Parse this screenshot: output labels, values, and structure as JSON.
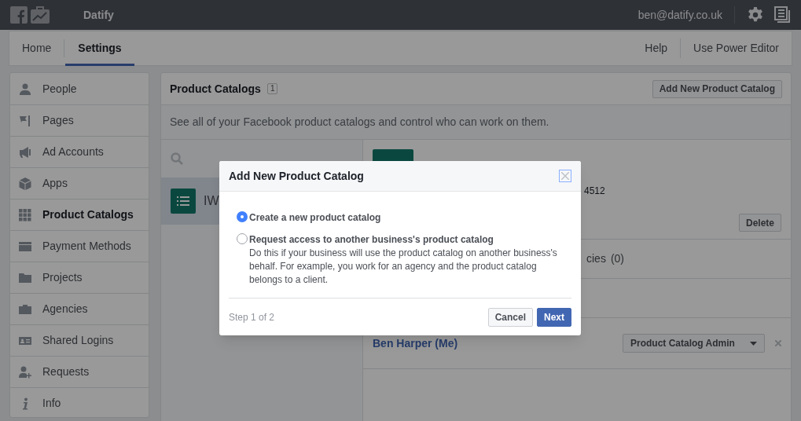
{
  "top_bar": {
    "app_name": "Datify",
    "account": "ben@datify.co.uk"
  },
  "nav": {
    "tabs": [
      {
        "label": "Home",
        "selected": false
      },
      {
        "label": "Settings",
        "selected": true
      }
    ],
    "links": [
      "Help",
      "Use Power Editor"
    ]
  },
  "sidebar": {
    "items": [
      {
        "label": "People",
        "selected": false
      },
      {
        "label": "Pages",
        "selected": false
      },
      {
        "label": "Ad Accounts",
        "selected": false
      },
      {
        "label": "Apps",
        "selected": false
      },
      {
        "label": "Product Catalogs",
        "selected": true
      },
      {
        "label": "Payment Methods",
        "selected": false
      },
      {
        "label": "Projects",
        "selected": false
      },
      {
        "label": "Agencies",
        "selected": false
      },
      {
        "label": "Shared Logins",
        "selected": false
      },
      {
        "label": "Requests",
        "selected": false
      },
      {
        "label": "Info",
        "selected": false
      }
    ]
  },
  "panel": {
    "title": "Product Catalogs",
    "count": "1",
    "add_button": "Add New Product Catalog",
    "description": "See all of your Facebook product catalogs and control who can work on them.",
    "catalog_list": [
      {
        "label": "IW",
        "selected": true
      }
    ],
    "detail": {
      "id_fragment": "4512",
      "delete_button": "Delete",
      "tab_fragment": "cies",
      "tab_count": "(0)",
      "people": [
        {
          "name": "Ben Harper (Me)",
          "role": "Product Catalog Admin"
        }
      ]
    }
  },
  "dialog": {
    "title": "Add New Product Catalog",
    "options": [
      {
        "label": "Create a new product catalog",
        "selected": true
      },
      {
        "label": "Request access to another business's product catalog",
        "selected": false,
        "description": "Do this if your business will use the product catalog on another business's behalf. For example, you work for an agency and the product catalog belongs to a client."
      }
    ],
    "step": "Step 1 of 2",
    "buttons": [
      "Cancel",
      "Next"
    ]
  }
}
